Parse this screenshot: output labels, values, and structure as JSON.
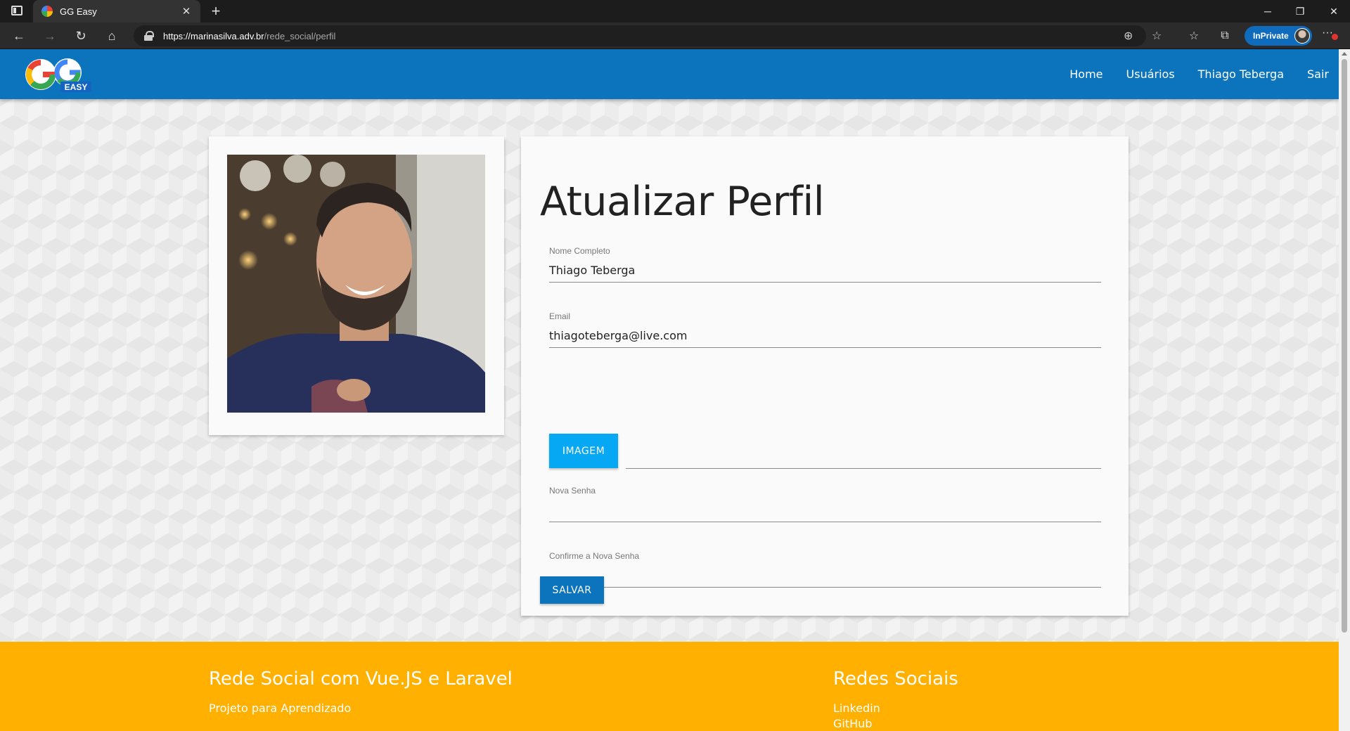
{
  "browser": {
    "tab_title": "GG Easy",
    "url_host": "https://marinasilva.adv.br",
    "url_path": "/rede_social/perfil",
    "inprivate_label": "InPrivate"
  },
  "site": {
    "logo_letters": "GG",
    "logo_tagline": "EASY",
    "nav": [
      "Home",
      "Usuários",
      "Thiago Teberga",
      "Sair"
    ]
  },
  "form": {
    "title": "Atualizar Perfil",
    "name_label": "Nome Completo",
    "name_value": "Thiago Teberga",
    "email_label": "Email",
    "email_value": "thiagoteberga@live.com",
    "image_button": "IMAGEM",
    "password_label": "Nova Senha",
    "password_value": "",
    "confirm_label": "Confirme a Nova Senha",
    "confirm_value": "",
    "save_button": "SALVAR"
  },
  "footer": {
    "left_title": "Rede Social com Vue.JS e Laravel",
    "left_text": "Projeto para Aprendizado",
    "right_title": "Redes Sociais",
    "links": [
      "Linkedin",
      "GitHub"
    ]
  },
  "colors": {
    "nav_blue": "#0b74bd",
    "image_button": "#06a8f4",
    "footer_orange": "#ffb000"
  }
}
